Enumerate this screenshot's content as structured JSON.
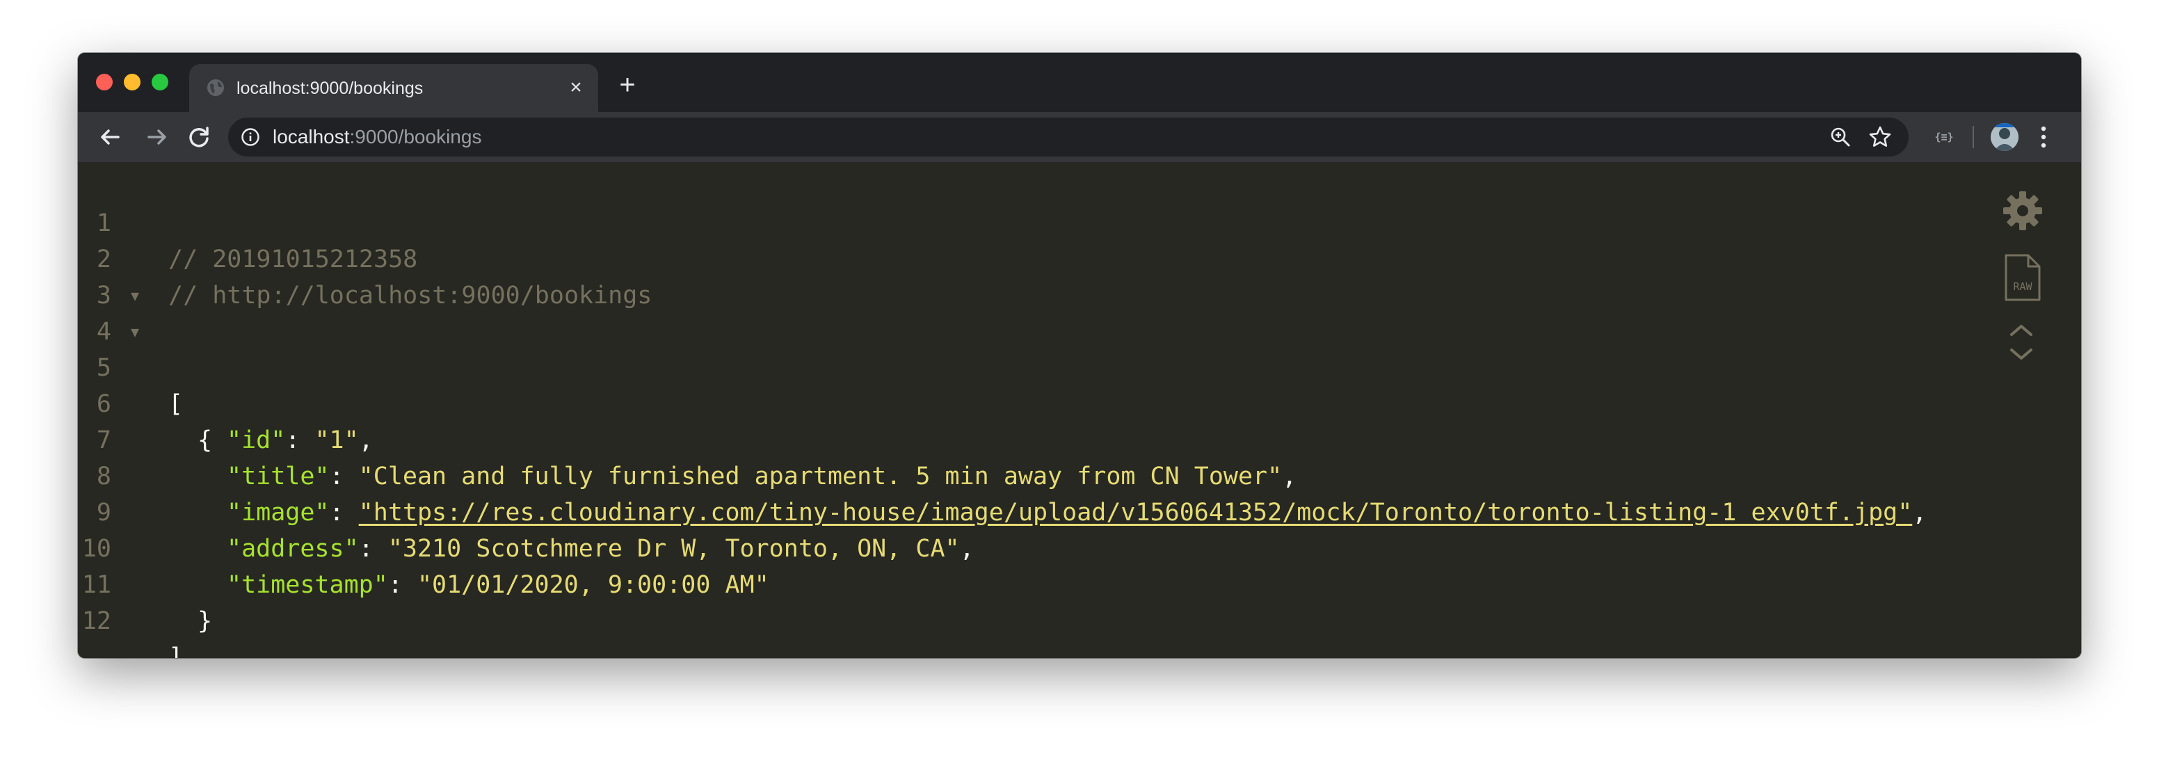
{
  "browser": {
    "tab": {
      "title": "localhost:9000/bookings",
      "favicon": "globe-icon",
      "close_glyph": "×"
    },
    "new_tab_glyph": "+",
    "address_bar": {
      "host": "localhost",
      "rest": ":9000/bookings"
    },
    "extension_label": "{≡}",
    "colors": {
      "frame": "#202124",
      "toolbar": "#35363a",
      "omnibox": "#202124"
    }
  },
  "json_viewer": {
    "colors": {
      "background": "#272822",
      "comment": "#75715e",
      "key": "#a6e22e",
      "string": "#e6db74",
      "punctuation": "#f8f8f2"
    },
    "lines": [
      {
        "number": "1",
        "comment": "// 20191015212358"
      },
      {
        "number": "2",
        "comment": "// http://localhost:9000/bookings"
      },
      {
        "number": "3"
      },
      {
        "number": "4",
        "open": "["
      },
      {
        "number": "5",
        "open": "{"
      },
      {
        "number": "6",
        "key": "\"id\"",
        "sep": ": ",
        "value": "\"1\"",
        "tail": ","
      },
      {
        "number": "7",
        "key": "\"title\"",
        "sep": ": ",
        "value": "\"Clean and fully furnished apartment. 5 min away from CN Tower\"",
        "tail": ","
      },
      {
        "number": "8",
        "key": "\"image\"",
        "sep": ": ",
        "link": "\"https://res.cloudinary.com/tiny-house/image/upload/v1560641352/mock/Toronto/toronto-listing-1_exv0tf.jpg\"",
        "tail": ","
      },
      {
        "number": "9",
        "key": "\"address\"",
        "sep": ": ",
        "value": "\"3210 Scotchmere Dr W, Toronto, ON, CA\"",
        "tail": ","
      },
      {
        "number": "10",
        "key": "\"timestamp\"",
        "sep": ": ",
        "value": "\"01/01/2020, 9:00:00 AM\""
      },
      {
        "number": "11",
        "close": "}"
      },
      {
        "number": "12",
        "close": "]"
      }
    ],
    "fold_glyph": "▼",
    "side_icons": {
      "settings": "gear-icon",
      "raw": "raw-file-icon",
      "raw_label": "RAW",
      "collapse": "chevron-up-icon",
      "expand": "chevron-down-icon"
    }
  }
}
